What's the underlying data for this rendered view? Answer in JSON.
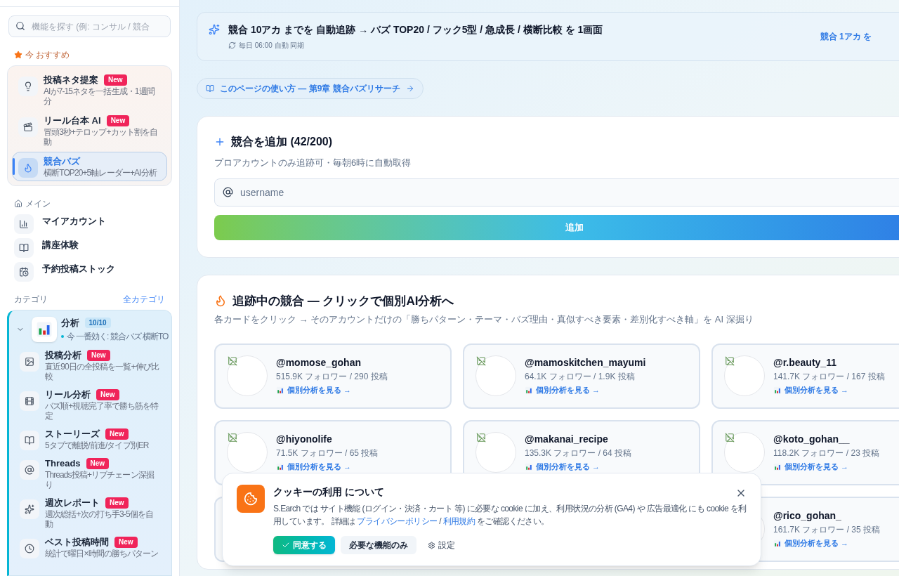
{
  "sidebar": {
    "search": {
      "placeholder": "機能を探す (例: コンサル / 競合"
    },
    "featured": {
      "label": "今 おすすめ",
      "items": [
        {
          "title": "投稿ネタ提案",
          "badge": "New",
          "desc": "AIが7-15ネタを一括生成・1週間分",
          "selected": false
        },
        {
          "title": "リール台本 AI",
          "badge": "New",
          "desc": "冒頭3秒+テロップ+カット割を自動",
          "selected": false
        },
        {
          "title": "競合バズ",
          "desc": "横断TOP20+5軸レーダー+AI分析",
          "selected": true
        }
      ]
    },
    "main": {
      "label": "メイン",
      "items": [
        {
          "title": "マイアカウント"
        },
        {
          "title": "講座体験"
        },
        {
          "title": "予約投稿ストック"
        }
      ]
    },
    "categories": {
      "label": "カテゴリ",
      "link": "全カテゴリ",
      "group": {
        "title": "分析",
        "count": "10/10",
        "hint": "今 一番効く: 競合バズ 横断TO",
        "expanded": true,
        "items": [
          {
            "title": "投稿分析",
            "badge": "New",
            "desc": "直近90日の全投稿を一覧+伸び比較"
          },
          {
            "title": "リール分析",
            "badge": "New",
            "desc": "バズ順+視聴完了率で勝ち筋を特定"
          },
          {
            "title": "ストーリーズ",
            "badge": "New",
            "desc": "5タブで離脱/前進/タイプ別ER"
          },
          {
            "title": "Threads",
            "badge": "New",
            "desc": "Threads投稿+リプチェーン深掘り"
          },
          {
            "title": "週次レポート",
            "badge": "New",
            "desc": "週次総括+次の打ち手3-5個を自動"
          },
          {
            "title": "ベスト投稿時間",
            "badge": "New",
            "desc": "統計で曜日×時間の勝ちパターン"
          }
        ]
      }
    }
  },
  "banner": {
    "title": "競合 10アカ までを 自動追跡 → バズ TOP20 / フック5型 / 急成長 / 横断比較 を 1画面",
    "sync": "毎日 06:00 自動 同期",
    "link": "競合 1アカ を"
  },
  "guide_link": "このページの使い方 — 第9章 競合バズリサーチ",
  "add_card": {
    "title": "競合を追加 (42/200)",
    "subtitle": "プロアカウントのみ追跡可・毎朝6時に自動取得",
    "input": {
      "placeholder": "username"
    },
    "button": "追加"
  },
  "tracked": {
    "title": "追跡中の競合 — クリックで個別AI分析へ",
    "subtitle": "各カードをクリック → そのアカウントだけの「勝ちパターン・テーマ・バズ理由・真似すべき要素・差別化すべき軸」を AI 深掘り",
    "cards": [
      {
        "kind": "account",
        "handle": "@momose_gohan",
        "stats": "515.9K フォロワー / 290 投稿",
        "link": "個別分析を見る →"
      },
      {
        "kind": "account",
        "handle": "@mamoskitchen_mayumi",
        "stats": "64.1K フォロワー / 1.9K 投稿",
        "link": "個別分析を見る →"
      },
      {
        "kind": "account",
        "handle": "@r.beauty_11",
        "stats": "141.7K フォロワー / 167 投稿",
        "link": "個別分析を見る →"
      },
      {
        "kind": "account",
        "handle": "@hiyonolife",
        "stats": "71.5K フォロワー / 65 投稿",
        "link": "個別分析を見る →"
      },
      {
        "kind": "account",
        "handle": "@makanai_recipe",
        "stats": "135.3K フォロワー / 64 投稿",
        "link": "個別分析を見る →"
      },
      {
        "kind": "account",
        "handle": "@koto_gohan__",
        "stats": "118.2K フォロワー / 23 投稿",
        "link": "個別分析を見る →"
      },
      {
        "kind": "covered"
      },
      {
        "kind": "gap"
      },
      {
        "kind": "account_covered",
        "handle": "@rico_gohan_",
        "stats": "161.7K フォロワー / 35 投稿",
        "link": "個別分析を見る →"
      }
    ]
  },
  "cookie": {
    "title": "クッキーの利用 について",
    "body": "S.Earch では サイト機能 (ログイン・決済・カート 等) に必要な cookie に加え、利用状況の分析 (GA4) や 広告最適化 にも cookie を利用しています。 詳細は",
    "links": [
      "プライバシーポリシー",
      "利用規約"
    ],
    "separator": "/",
    "tail": "をご確認ください。",
    "accept": "同意する",
    "necessary": "必要な機能のみ",
    "settings": "設定"
  }
}
